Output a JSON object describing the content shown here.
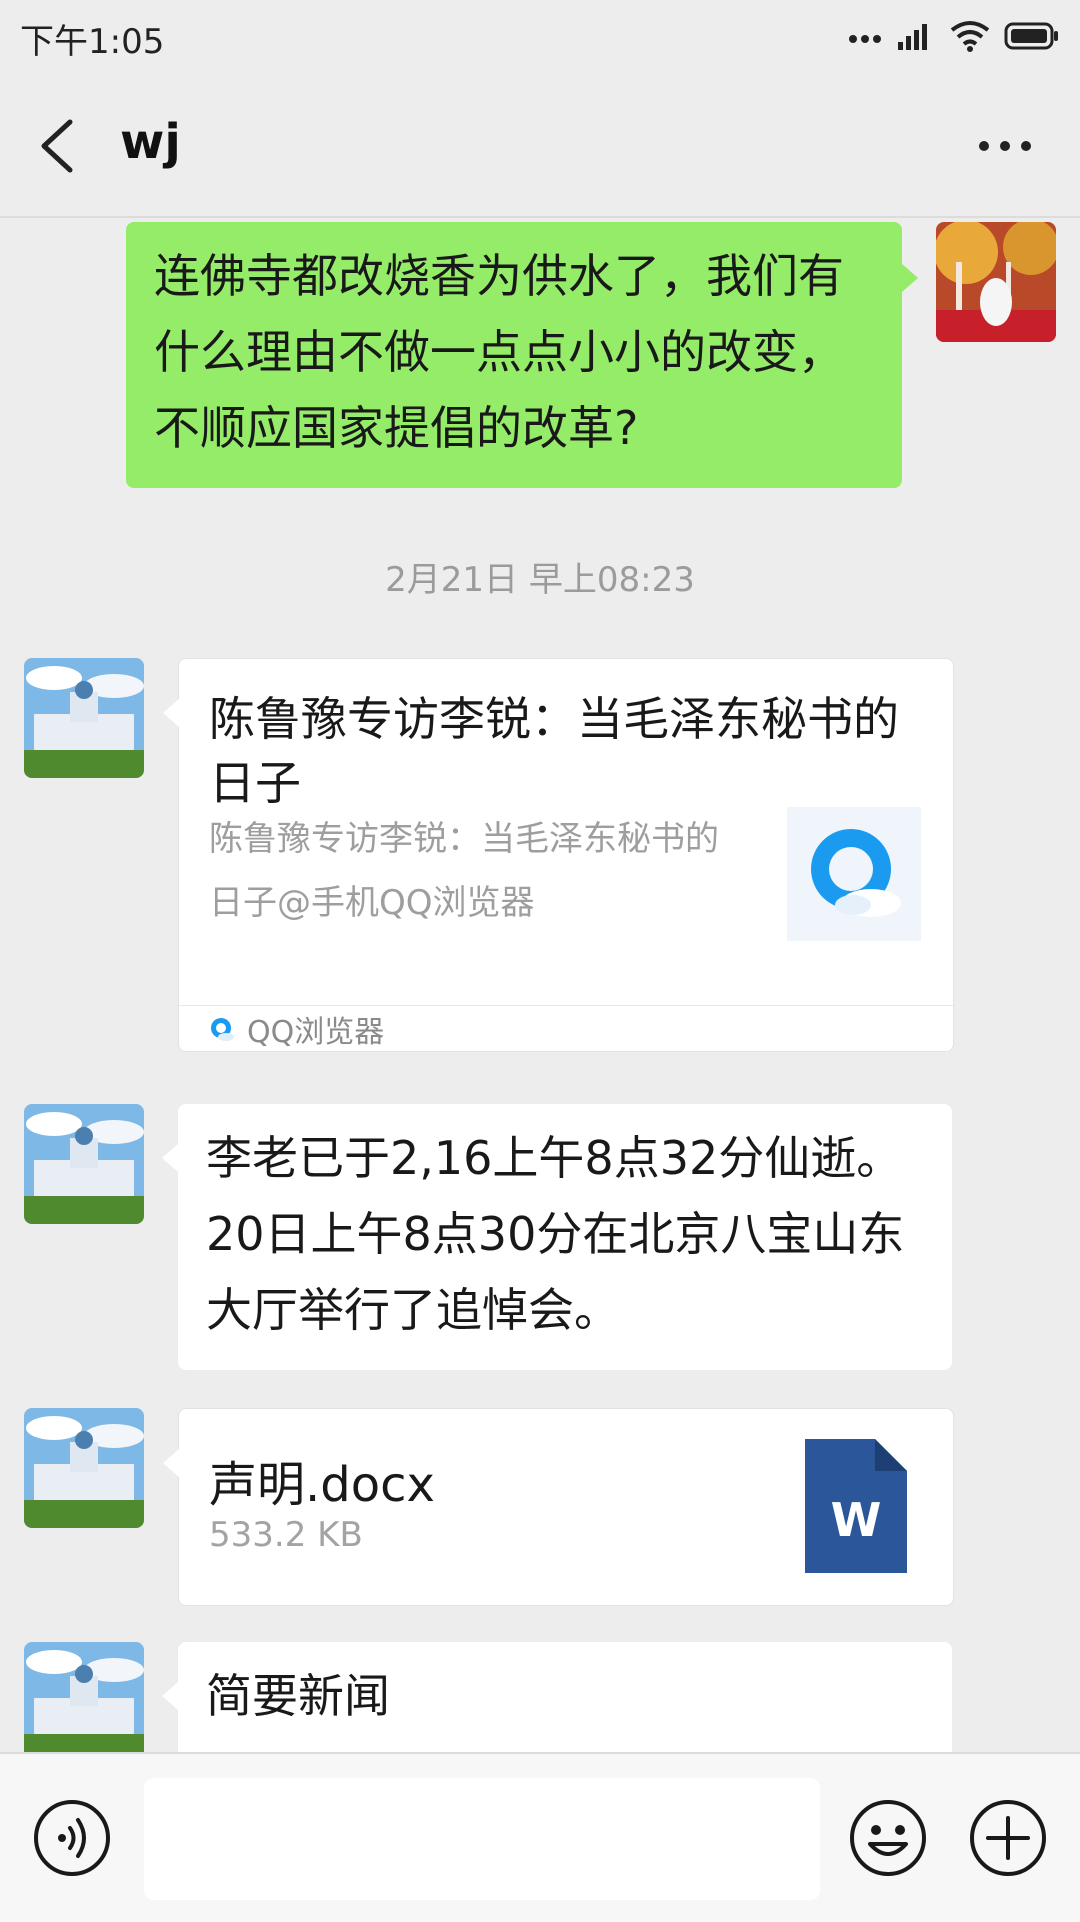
{
  "status_bar": {
    "time": "下午1:05"
  },
  "header": {
    "title": "wj"
  },
  "messages": {
    "sent_text": "连佛寺都改烧香为供水了，我们有什么理由不做一点点小小的改变，不顺应国家提倡的改革?",
    "timestamp": "2月21日 早上08:23",
    "link_card": {
      "title": "陈鲁豫专访李锐：当毛泽东秘书的日子",
      "description": "陈鲁豫专访李锐：当毛泽东秘书的日子@手机QQ浏览器",
      "source": "QQ浏览器"
    },
    "received_text": "李老已于2,16上午8点32分仙逝。20日上午8点30分在北京八宝山东大厅举行了追悼会。",
    "file": {
      "name": "声明.docx",
      "size": "533.2 KB",
      "icon_letter": "W"
    },
    "partial_text": "简要新闻"
  },
  "input_bar": {
    "placeholder": ""
  },
  "colors": {
    "sent_bubble": "#95ec69",
    "background": "#ededed",
    "word_icon": "#2b579a"
  }
}
